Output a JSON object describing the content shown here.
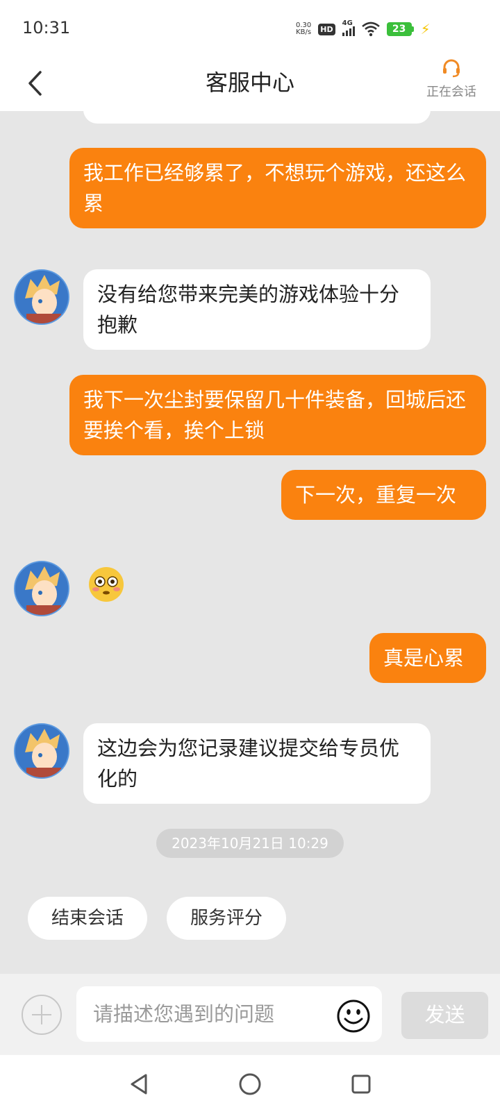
{
  "status_bar": {
    "time": "10:31",
    "net_speed_value": "0.30",
    "net_speed_unit": "KB/s",
    "hd_label": "HD",
    "signal_label": "4G",
    "battery": "23"
  },
  "header": {
    "title": "客服中心",
    "status_label": "正在会话"
  },
  "messages": [
    {
      "sender": "user",
      "text": "我工作已经够累了，不想玩个游戏，还这么累"
    },
    {
      "sender": "agent",
      "text": "没有给您带来完美的游戏体验十分抱歉"
    },
    {
      "sender": "user",
      "text": "我下一次尘封要保留几十件装备，回城后还要挨个看，挨个上锁"
    },
    {
      "sender": "user",
      "text": "下一次，重复一次"
    },
    {
      "sender": "agent",
      "emoji": "flushed-face-emoji"
    },
    {
      "sender": "user",
      "text": "真是心累"
    },
    {
      "sender": "agent",
      "text": "这边会为您记录建议提交给专员优化的"
    }
  ],
  "timestamp": "2023年10月21日 10:29",
  "quick_actions": {
    "end_session": "结束会话",
    "rate_service": "服务评分"
  },
  "input": {
    "placeholder": "请描述您遇到的问题",
    "send_label": "发送"
  },
  "colors": {
    "accent": "#fa820f",
    "background": "#e6e6e6"
  }
}
